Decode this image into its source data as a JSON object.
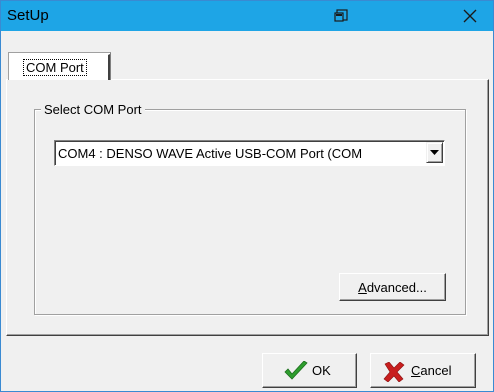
{
  "window": {
    "title": "SetUp"
  },
  "tabs": [
    {
      "label": "COM Port",
      "hotkey_index": 0
    }
  ],
  "group": {
    "label": "Select  COM Port"
  },
  "com_port_select": {
    "selected": "COM4 : DENSO WAVE Active USB-COM Port (COM"
  },
  "buttons": {
    "advanced": "Advanced...",
    "ok": "OK",
    "cancel": "Cancel"
  },
  "colors": {
    "titlebar": "#1ea5e6",
    "ok_check": "#2e9e2e",
    "cancel_x": "#c81e1e"
  },
  "icons": {
    "title": "window-restore-icon",
    "close": "close-icon",
    "dropdown": "chevron-down-icon",
    "ok": "checkmark-icon",
    "cancel": "x-mark-icon"
  }
}
